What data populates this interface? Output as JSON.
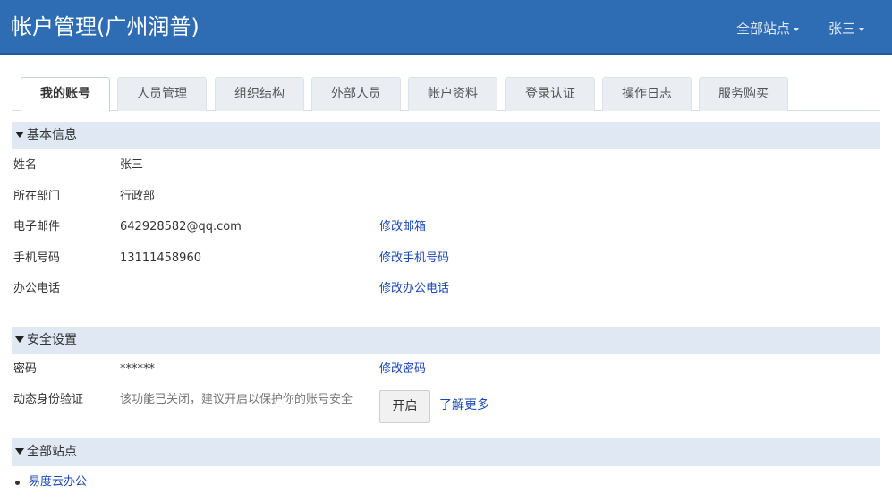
{
  "header": {
    "title": "帐户管理(广州润普)",
    "sites_menu": "全部站点",
    "user_menu": "张三",
    "background_color": "#2e6db4"
  },
  "tabs": [
    {
      "label": "我的账号",
      "active": true
    },
    {
      "label": "人员管理"
    },
    {
      "label": "组织结构"
    },
    {
      "label": "外部人员"
    },
    {
      "label": "帐户资料"
    },
    {
      "label": "登录认证"
    },
    {
      "label": "操作日志"
    },
    {
      "label": "服务购买"
    }
  ],
  "basic_info": {
    "title": "基本信息",
    "name": {
      "label": "姓名",
      "value": "张三"
    },
    "department": {
      "label": "所在部门",
      "value": "行政部"
    },
    "email": {
      "label": "电子邮件",
      "value": "642928582@qq.com",
      "action": "修改邮箱"
    },
    "mobile": {
      "label": "手机号码",
      "value": "13111458960",
      "action": "修改手机号码"
    },
    "office_phone": {
      "label": "办公电话",
      "value": "",
      "action": "修改办公电话"
    }
  },
  "security": {
    "title": "安全设置",
    "password": {
      "label": "密码",
      "value": "******",
      "action": "修改密码"
    },
    "two_factor": {
      "label": "动态身份验证",
      "status_text": "该功能已关闭，建议开启以保护你的账号安全",
      "button": "开启",
      "learn_more": "了解更多"
    }
  },
  "sites": {
    "title": "全部站点",
    "items": [
      "易度云办公"
    ]
  },
  "colors": {
    "link": "#1a47b8",
    "section_background": "#dfe8f3"
  }
}
